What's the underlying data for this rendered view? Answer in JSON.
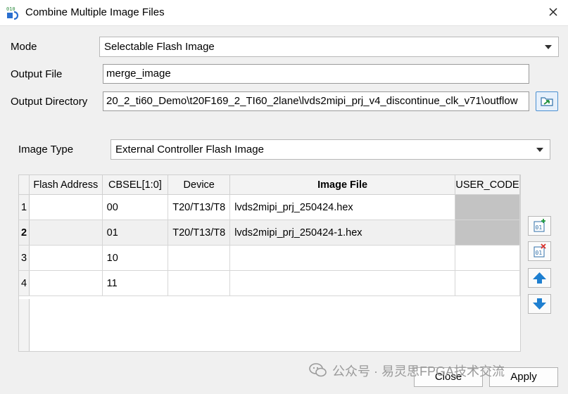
{
  "window": {
    "title": "Combine Multiple Image Files",
    "icon": "combine-files-icon",
    "close_icon": "close-icon"
  },
  "form": {
    "mode_label": "Mode",
    "mode_value": "Selectable Flash Image",
    "output_file_label": "Output File",
    "output_file_value": "merge_image",
    "output_dir_label": "Output Directory",
    "output_dir_value": "20_2_ti60_Demo\\t20F169_2_TI60_2lane\\lvds2mipi_prj_v4_discontinue_clk_v71\\outflow",
    "browse_icon": "folder-browse-icon",
    "image_type_label": "Image Type",
    "image_type_value": "External Controller Flash Image"
  },
  "table": {
    "columns": [
      "Flash Address",
      "CBSEL[1:0]",
      "Device",
      "Image File",
      "USER_CODE"
    ],
    "rows": [
      {
        "num": "1",
        "flash_address": "",
        "cbsel": "00",
        "device": "T20/T13/T8",
        "image_file": "lvds2mipi_prj_250424.hex",
        "user_code": ""
      },
      {
        "num": "2",
        "flash_address": "",
        "cbsel": "01",
        "device": "T20/T13/T8",
        "image_file": "lvds2mipi_prj_250424-1.hex",
        "user_code": ""
      },
      {
        "num": "3",
        "flash_address": "",
        "cbsel": "10",
        "device": "",
        "image_file": "",
        "user_code": ""
      },
      {
        "num": "4",
        "flash_address": "",
        "cbsel": "11",
        "device": "",
        "image_file": "",
        "user_code": ""
      }
    ]
  },
  "side_buttons": {
    "add_icon": "add-file-icon",
    "remove_icon": "remove-file-icon",
    "up_icon": "move-up-icon",
    "down_icon": "move-down-icon"
  },
  "buttons": {
    "close_label": "Close",
    "apply_label": "Apply"
  },
  "watermark": {
    "text": "公众号 · 易灵思FPGA技术交流",
    "icon": "wechat-icon"
  }
}
